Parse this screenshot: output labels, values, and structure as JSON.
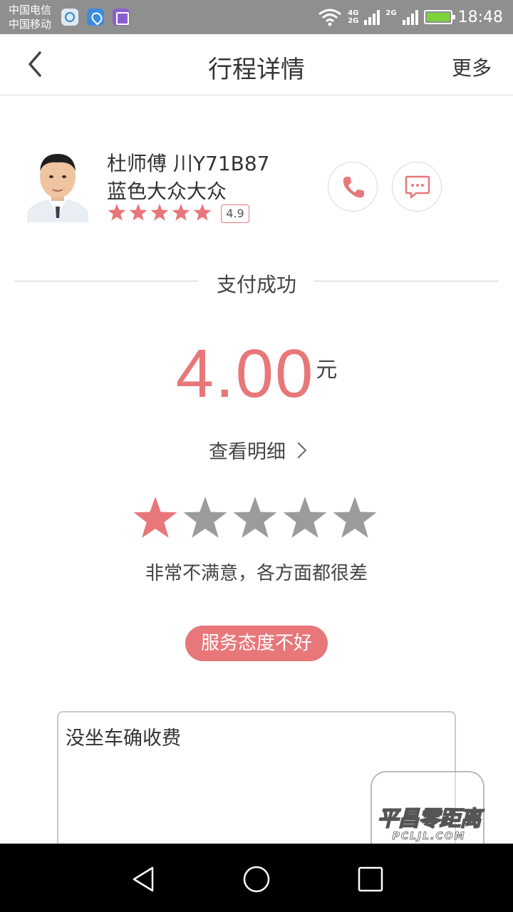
{
  "status_bar": {
    "carrier_1": "中国电信",
    "carrier_2": "中国移动",
    "net_top": "4G",
    "net_bottom": "2G",
    "net_second": "2G",
    "time": "18:48",
    "icons": [
      "app-notification-icon",
      "location-app-icon",
      "gallery-app-icon",
      "wifi-icon",
      "signal-icon",
      "battery-charging-icon"
    ]
  },
  "header": {
    "back_icon": "chevron-left-icon",
    "title": "行程详情",
    "more_label": "更多"
  },
  "driver": {
    "name_plate": "杜师傅 川Y71B87",
    "car": "蓝色大众大众",
    "stars": 5,
    "rating": "4.9",
    "call_icon": "phone-icon",
    "message_icon": "chat-bubble-icon"
  },
  "payment": {
    "status": "支付成功",
    "amount": "4.00",
    "unit": "元",
    "detail_link": "查看明细"
  },
  "rating": {
    "selected": 1,
    "max": 5,
    "description": "非常不满意，各方面都很差",
    "tag": "服务态度不好"
  },
  "comment": {
    "text": "没坐车确收费"
  },
  "watermark": {
    "title": "平昌零距离",
    "sub": "PCLJL.COM"
  },
  "colors": {
    "accent": "#e8777a",
    "star_inactive": "#9b9b9b",
    "status_bar": "#8f8f8f",
    "nav_bar": "#000000"
  }
}
